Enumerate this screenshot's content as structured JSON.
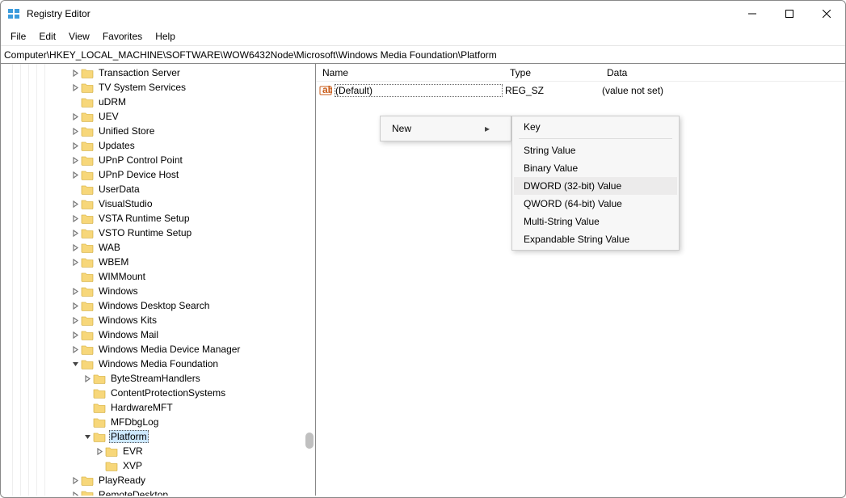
{
  "window": {
    "title": "Registry Editor"
  },
  "menu": [
    "File",
    "Edit",
    "View",
    "Favorites",
    "Help"
  ],
  "address": "Computer\\HKEY_LOCAL_MACHINE\\SOFTWARE\\WOW6432Node\\Microsoft\\Windows Media Foundation\\Platform",
  "columns": {
    "name": "Name",
    "type": "Type",
    "data": "Data"
  },
  "value_row": {
    "name": "(Default)",
    "type": "REG_SZ",
    "data": "(value not set)"
  },
  "tree": [
    {
      "depth": 5,
      "exp": ">",
      "label": "Transaction Server"
    },
    {
      "depth": 5,
      "exp": ">",
      "label": "TV System Services"
    },
    {
      "depth": 5,
      "exp": "",
      "label": "uDRM"
    },
    {
      "depth": 5,
      "exp": ">",
      "label": "UEV"
    },
    {
      "depth": 5,
      "exp": ">",
      "label": "Unified Store"
    },
    {
      "depth": 5,
      "exp": ">",
      "label": "Updates"
    },
    {
      "depth": 5,
      "exp": ">",
      "label": "UPnP Control Point"
    },
    {
      "depth": 5,
      "exp": ">",
      "label": "UPnP Device Host"
    },
    {
      "depth": 5,
      "exp": "",
      "label": "UserData"
    },
    {
      "depth": 5,
      "exp": ">",
      "label": "VisualStudio"
    },
    {
      "depth": 5,
      "exp": ">",
      "label": "VSTA Runtime Setup"
    },
    {
      "depth": 5,
      "exp": ">",
      "label": "VSTO Runtime Setup"
    },
    {
      "depth": 5,
      "exp": ">",
      "label": "WAB"
    },
    {
      "depth": 5,
      "exp": ">",
      "label": "WBEM"
    },
    {
      "depth": 5,
      "exp": "",
      "label": "WIMMount"
    },
    {
      "depth": 5,
      "exp": ">",
      "label": "Windows"
    },
    {
      "depth": 5,
      "exp": ">",
      "label": "Windows Desktop Search"
    },
    {
      "depth": 5,
      "exp": ">",
      "label": "Windows Kits"
    },
    {
      "depth": 5,
      "exp": ">",
      "label": "Windows Mail"
    },
    {
      "depth": 5,
      "exp": ">",
      "label": "Windows Media Device Manager"
    },
    {
      "depth": 5,
      "exp": "v",
      "label": "Windows Media Foundation"
    },
    {
      "depth": 6,
      "exp": ">",
      "label": "ByteStreamHandlers"
    },
    {
      "depth": 6,
      "exp": "",
      "label": "ContentProtectionSystems"
    },
    {
      "depth": 6,
      "exp": "",
      "label": "HardwareMFT"
    },
    {
      "depth": 6,
      "exp": "",
      "label": "MFDbgLog"
    },
    {
      "depth": 6,
      "exp": "v",
      "label": "Platform",
      "selected": true
    },
    {
      "depth": 7,
      "exp": ">",
      "label": "EVR"
    },
    {
      "depth": 7,
      "exp": "",
      "label": "XVP"
    },
    {
      "depth": 5,
      "exp": ">",
      "label": "PlayReady"
    },
    {
      "depth": 5,
      "exp": ">",
      "label": "RemoteDesktop"
    }
  ],
  "context_menu_primary": {
    "new": "New"
  },
  "context_menu_new": [
    "Key",
    "-",
    "String Value",
    "Binary Value",
    "DWORD (32-bit) Value",
    "QWORD (64-bit) Value",
    "Multi-String Value",
    "Expandable String Value"
  ],
  "context_menu_highlight": 4
}
